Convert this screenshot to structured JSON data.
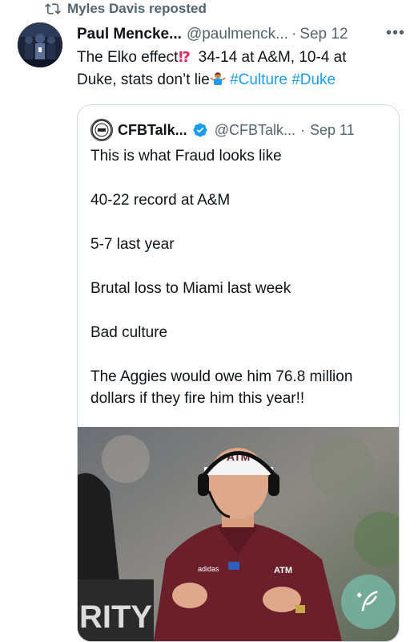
{
  "repost": {
    "label": "Myles Davis reposted",
    "icon": "repost-icon"
  },
  "post": {
    "display_name": "Paul Mencke...",
    "handle": "@paulmenck...",
    "separator": "·",
    "date": "Sep 12",
    "more": "•••",
    "text_line1_a": "The Elko effect",
    "text_line1_b": " 34-14 at A&M, 10-4 at",
    "text_line2_a": "Duke, stats don’t lie",
    "hashtag1": "#Culture",
    "hashtag2": "#Duke"
  },
  "quoted": {
    "display_name": "CFBTalk...",
    "handle": "@CFBTalk...",
    "separator": "·",
    "date": "Sep 11",
    "paragraphs": [
      "This is what Fraud looks like",
      "40-22 record at A&M",
      "5-7 last year",
      "Brutal loss to Miami last week",
      "Bad culture",
      "The Aggies would owe him 76.8 million dollars if they fire him this year!!"
    ],
    "image_text": {
      "cap": "ATM",
      "shirt_logo": "ATM",
      "brand": "adidas",
      "jersey": "RITY"
    }
  },
  "colors": {
    "link": "#1d9bf0",
    "muted": "#536471",
    "maroon": "#6b1f2a",
    "verified": "#1d9bf0",
    "fab": "#78beaa"
  }
}
